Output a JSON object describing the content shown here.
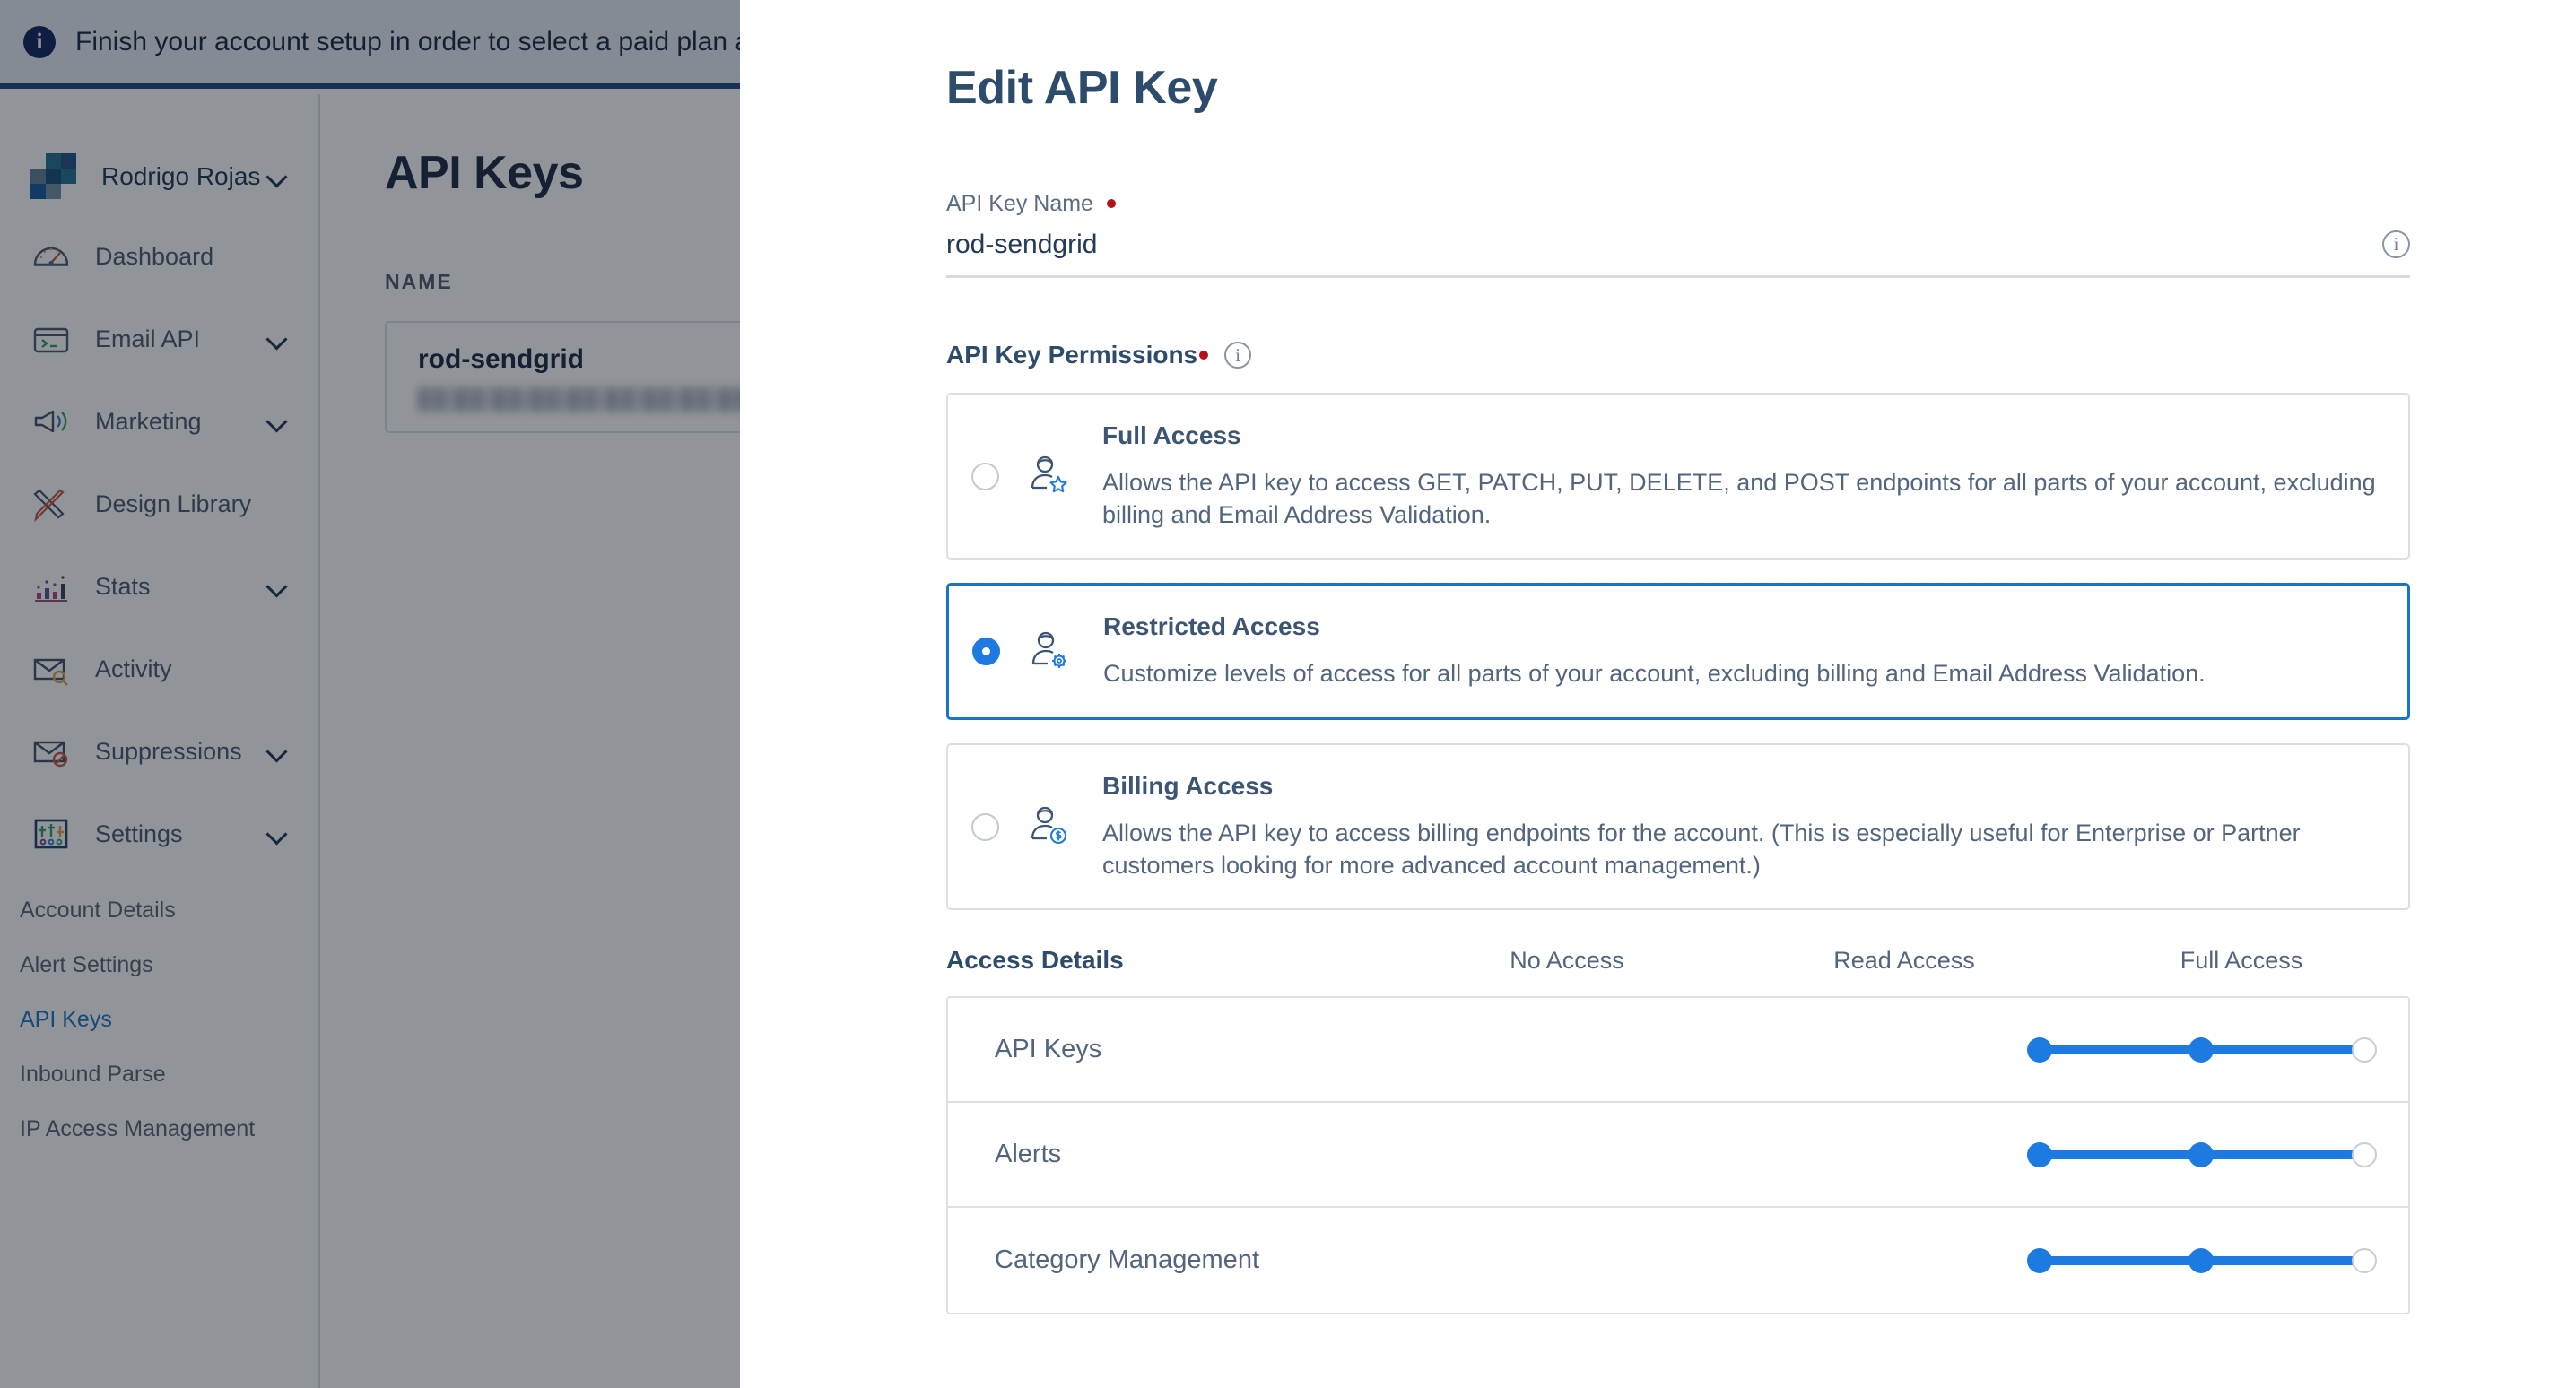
{
  "banner": {
    "icon": "info-circle-icon",
    "text": "Finish your account setup in order to select a paid plan an"
  },
  "sidebar": {
    "account": {
      "name": "Rodrigo Rojas",
      "chevron": "chevron-down-icon",
      "logo": "sendgrid-logo-icon"
    },
    "items": [
      {
        "label": "Dashboard",
        "icon": "gauge-icon",
        "chevron": false
      },
      {
        "label": "Email API",
        "icon": "terminal-icon",
        "chevron": true
      },
      {
        "label": "Marketing",
        "icon": "megaphone-icon",
        "chevron": true
      },
      {
        "label": "Design Library",
        "icon": "pencil-ruler-icon",
        "chevron": false
      },
      {
        "label": "Stats",
        "icon": "bar-chart-icon",
        "chevron": true
      },
      {
        "label": "Activity",
        "icon": "envelope-search-icon",
        "chevron": false
      },
      {
        "label": "Suppressions",
        "icon": "envelope-block-icon",
        "chevron": true
      },
      {
        "label": "Settings",
        "icon": "sliders-icon",
        "chevron": true
      }
    ],
    "sub_items": [
      {
        "label": "Account Details",
        "active": false
      },
      {
        "label": "Alert Settings",
        "active": false
      },
      {
        "label": "API Keys",
        "active": true
      },
      {
        "label": "Inbound Parse",
        "active": false
      },
      {
        "label": "IP Access Management",
        "active": false
      }
    ]
  },
  "page": {
    "title": "API Keys",
    "column_header": "NAME",
    "keys": [
      {
        "name": "rod-sendgrid",
        "id_masked": ""
      }
    ]
  },
  "modal": {
    "title": "Edit API Key",
    "name_field": {
      "label": "API Key Name",
      "required": true,
      "value": "rod-sendgrid",
      "placeholder": "API Key Name",
      "info_icon": "info-icon"
    },
    "permissions": {
      "label": "API Key Permissions",
      "required": true,
      "info_icon": "info-icon",
      "options": [
        {
          "id": "full",
          "title": "Full Access",
          "description": "Allows the API key to access GET, PATCH, PUT, DELETE, and POST endpoints for all parts of your account, excluding billing and Email Address Validation.",
          "icon": "person-star-icon",
          "selected": false
        },
        {
          "id": "restricted",
          "title": "Restricted Access",
          "description": "Customize levels of access for all parts of your account, excluding billing and Email Address Validation.",
          "icon": "person-gear-icon",
          "selected": true
        },
        {
          "id": "billing",
          "title": "Billing Access",
          "description": "Allows the API key to access billing endpoints for the account. (This is especially useful for Enterprise or Partner customers looking for more advanced account management.)",
          "icon": "person-dollar-icon",
          "selected": false
        }
      ]
    },
    "access_details": {
      "title": "Access Details",
      "columns": [
        "No Access",
        "Read Access",
        "Full Access"
      ],
      "rows": [
        {
          "label": "API Keys",
          "value": "Read Access"
        },
        {
          "label": "Alerts",
          "value": "Read Access"
        },
        {
          "label": "Category Management",
          "value": "Read Access"
        }
      ]
    }
  },
  "colors": {
    "accent_blue": "#1c7ae0",
    "link_blue": "#1a73c7",
    "title_navy": "#2d4b6b",
    "required_red": "#b3121b",
    "banner_border": "#1a4480"
  }
}
